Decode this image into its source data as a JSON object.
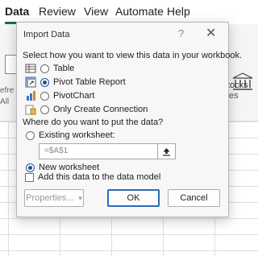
{
  "menubar": {
    "items": [
      {
        "label": "Data",
        "active": true
      },
      {
        "label": "Review"
      },
      {
        "label": "View"
      },
      {
        "label": "Automate"
      },
      {
        "label": "Help"
      }
    ]
  },
  "ribbon": {
    "left_partial_1": "efre",
    "left_partial_2": "All",
    "stocks_label": "tocks",
    "right_partial": "es"
  },
  "dialog": {
    "title": "Import Data",
    "help_glyph": "?",
    "close_glyph": "✕",
    "view_prompt": "Select how you want to view this data in your workbook.",
    "view_options": [
      {
        "label": "Table",
        "selected": false,
        "icon": "table-icon"
      },
      {
        "label": "Pivot Table Report",
        "selected": true,
        "icon": "pivot-table-icon"
      },
      {
        "label": "PivotChart",
        "selected": false,
        "icon": "pivot-chart-icon"
      },
      {
        "label": "Only Create Connection",
        "selected": false,
        "icon": "connection-icon"
      }
    ],
    "location_prompt": "Where do you want to put the data?",
    "existing_worksheet_label": "Existing worksheet:",
    "existing_worksheet_selected": false,
    "cell_reference_value": "=$A$1",
    "new_worksheet_label": "New worksheet",
    "new_worksheet_selected": true,
    "data_model_label": "Add this data to the data model",
    "data_model_checked": false,
    "properties_label": "Properties...",
    "properties_dropdown_glyph": "▾",
    "ok_label": "OK",
    "cancel_label": "Cancel"
  },
  "colors": {
    "accent": "#1a6c3e",
    "radio_selected": "#1d4f91",
    "default_button_border": "#2b6cb8"
  }
}
